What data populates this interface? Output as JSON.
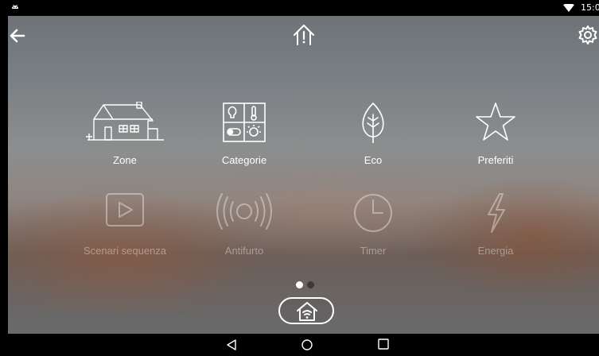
{
  "status_bar": {
    "time": "15:0",
    "icons": [
      "android-icon",
      "wifi-icon"
    ]
  },
  "top_bar": {
    "icons": [
      "back-arrow-icon",
      "home-alert-icon",
      "gear-icon"
    ]
  },
  "pages": {
    "total": 2,
    "active": 1
  },
  "tiles": [
    {
      "label": "Zone",
      "icon": "house-icon",
      "enabled": true
    },
    {
      "label": "Categorie",
      "icon": "categories-icon",
      "enabled": true
    },
    {
      "label": "Eco",
      "icon": "leaf-icon",
      "enabled": true
    },
    {
      "label": "Preferiti",
      "icon": "star-icon",
      "enabled": true
    },
    {
      "label": "Scenari sequenza",
      "icon": "play-icon",
      "enabled": false
    },
    {
      "label": "Antifurto",
      "icon": "alarm-icon",
      "enabled": false
    },
    {
      "label": "Timer",
      "icon": "clock-icon",
      "enabled": false
    },
    {
      "label": "Energia",
      "icon": "lightning-icon",
      "enabled": false
    }
  ],
  "bottom": {
    "home_button_icon": "home-wifi-icon"
  },
  "nav_bar": {
    "icons": [
      "back-triangle-icon",
      "home-circle-icon",
      "recents-square-icon"
    ]
  }
}
